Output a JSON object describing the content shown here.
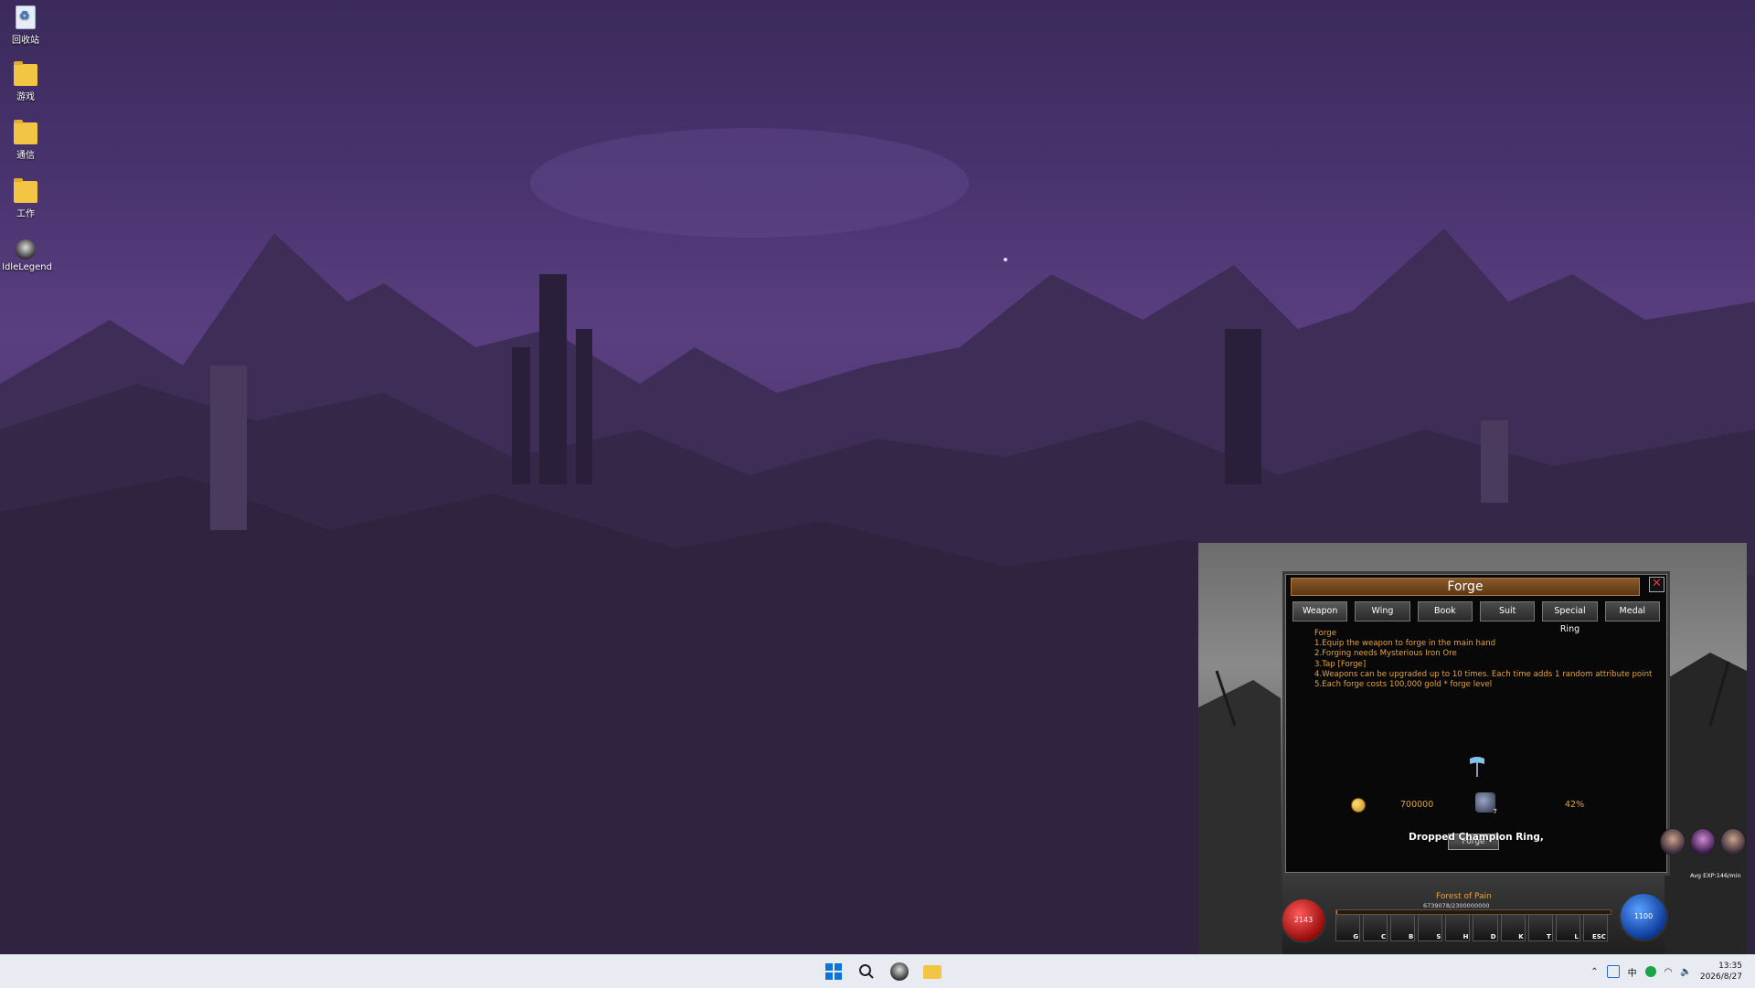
{
  "desktop": {
    "icons": [
      {
        "label": "回收站"
      },
      {
        "label": "游戏"
      },
      {
        "label": "通信"
      },
      {
        "label": "工作"
      },
      {
        "label": "IdleLegend"
      }
    ]
  },
  "game": {
    "forge_title": "Forge",
    "close_glyph": "✕",
    "tabs": [
      "Weapon",
      "Wing",
      "Book",
      "Suit",
      "Special Ring",
      "Medal"
    ],
    "description": [
      "Forge",
      "1.Equip the weapon to forge in the main hand",
      "2.Forging needs Mysterious Iron Ore",
      "3.Tap [Forge]",
      "4.Weapons can be upgraded up to 10 times. Each time adds 1 random attribute point",
      "5.Each forge costs 100,000 gold * forge level"
    ],
    "gold_cost": "700000",
    "ore_count": "7",
    "success_rate": "42%",
    "forge_button": "Forge",
    "dropped_message": "Dropped Champion Ring,",
    "hud": {
      "hp": "2143",
      "mp": "1100",
      "map_name": "Forest of Pain",
      "exp_text": "6739078/2300000000",
      "exp_fraction": 0.003,
      "avg_exp": "Avg EXP:146/min",
      "skill_keys": [
        "G",
        "C",
        "B",
        "S",
        "H",
        "D",
        "K",
        "T",
        "L",
        "ESC"
      ]
    }
  },
  "taskbar": {
    "tray_ime": "中",
    "time": "13:35",
    "date": "2026/8/27"
  }
}
